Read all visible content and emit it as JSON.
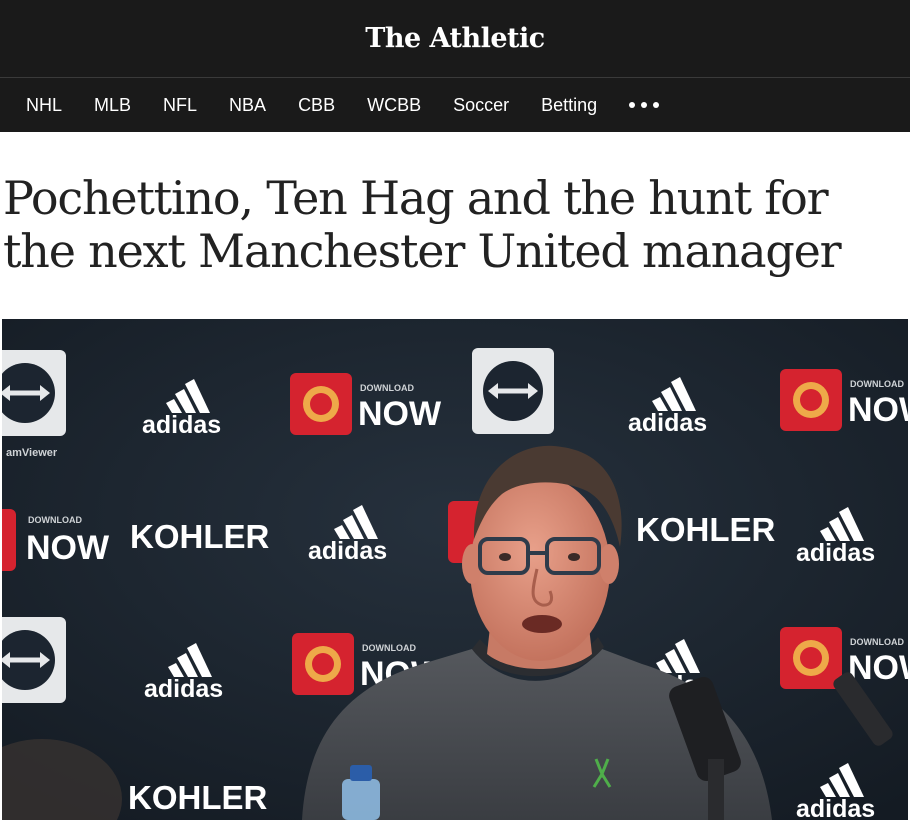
{
  "header": {
    "logo": "The Athletic"
  },
  "nav": {
    "items": [
      "NHL",
      "MLB",
      "NFL",
      "NBA",
      "CBB",
      "WCBB",
      "Soccer",
      "Betting"
    ],
    "more_icon": "more-dots-icon"
  },
  "article": {
    "headline_line1": "Pochettino, Ten Hag and the hunt for",
    "headline_line2": "the next Manchester United manager"
  },
  "hero_image": {
    "backdrop": {
      "adidas": "adidas",
      "kohler": "KOHLER",
      "download": "DOWNLOAD",
      "now": "NOW",
      "viewer": "amViewer"
    },
    "colors": {
      "backdrop": "#1c2530",
      "club_red": "#d5232f",
      "sweater": "#4a4d52"
    }
  }
}
